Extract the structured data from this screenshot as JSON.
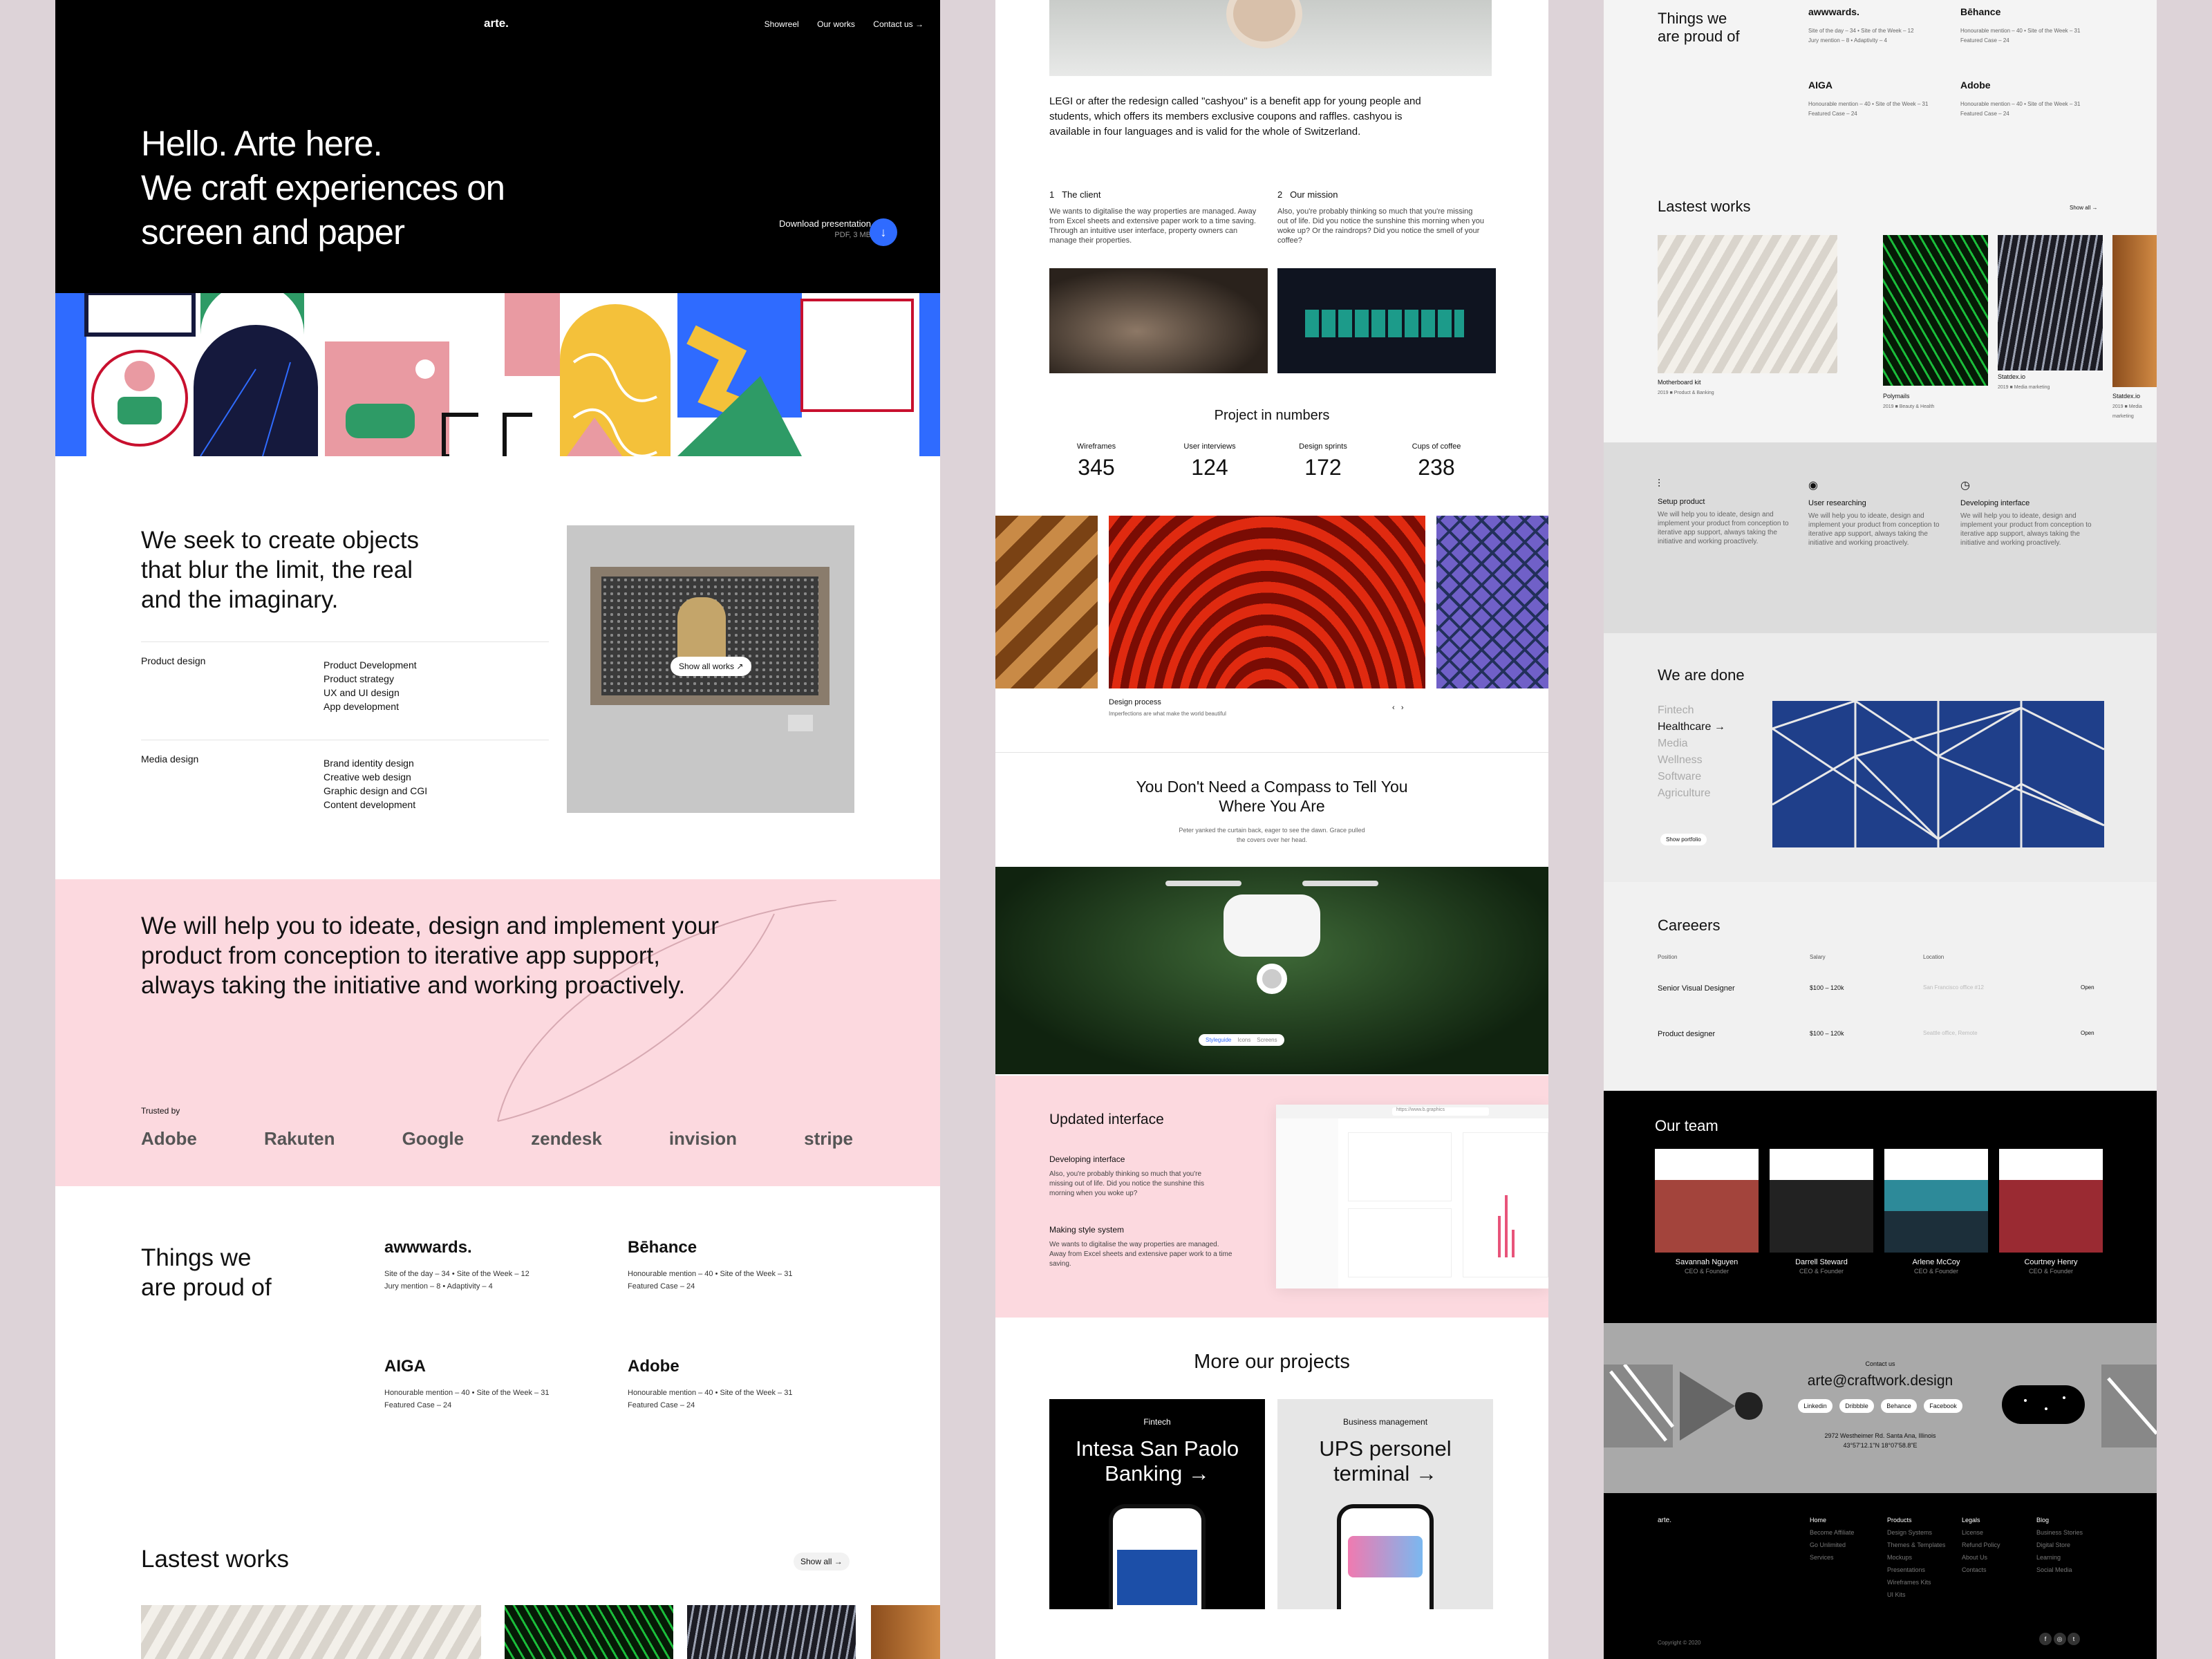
{
  "home": {
    "logo": "arte.",
    "nav": [
      "Showreel",
      "Our works",
      "Contact us →"
    ],
    "hero_title": "Hello. Arte here.\nWe craft experiences on\nscreen and paper",
    "download_label": "Download presentation",
    "download_meta": "PDF, 3 MB",
    "download_icon": "↓",
    "seek_text": "We seek to create objects\nthat blur the limit, the real\nand the imaginary.",
    "services": [
      {
        "heading": "Product design",
        "items": "Product Development\nProduct strategy\nUX and UI design\nApp development"
      },
      {
        "heading": "Media design",
        "items": "Brand identity design\nCreative web design\nGraphic design and CGI\nContent development"
      }
    ],
    "show_all_works": "Show all works ↗",
    "help_text": "We will help you to ideate, design and implement your product from conception to iterative app support, always taking the initiative and working proactively.",
    "trusted_by": "Trusted by",
    "client_logos": [
      "Adobe",
      "Rakuten",
      "Google",
      "zendesk",
      "invision",
      "stripe"
    ],
    "proud_title": "Things we\nare proud of",
    "awards": [
      {
        "name": "awwwards.",
        "text": "Site of the day – 34  •  Site of the Week – 12\nJury mention – 8  •  Adaptivity – 4"
      },
      {
        "name": "Bēhance",
        "text": "Honourable mention – 40  •  Site of the Week – 31\nFeatured Case – 24"
      },
      {
        "name": "AIGA",
        "text": "Honourable mention – 40  •  Site of the Week – 31\nFeatured Case – 24"
      },
      {
        "name": "Adobe",
        "text": "Honourable mention – 40  •  Site of the Week – 31\nFeatured Case – 24"
      }
    ],
    "latest_title": "Lastest works",
    "show_all": "Show all →"
  },
  "project": {
    "description": "LEGI or after the redesign called \"cashyou\" is a benefit app for young people and students, which offers its members exclusive coupons and raffles. cashyou is available in four languages and is valid for the whole of Switzerland.",
    "client": {
      "num": "1",
      "title": "The client",
      "text": "We wants to digitalise the way properties are managed. Away from Excel sheets and extensive paper work to a time saving. Through an intuitive user interface, property owners can manage their properties."
    },
    "mission": {
      "num": "2",
      "title": "Our mission",
      "text": "Also, you're probably thinking so much that you're missing out of life. Did you notice the sunshine this morning when you woke up? Or the raindrops? Did you notice the smell of your coffee?"
    },
    "numbers_title": "Project in numbers",
    "stats": [
      {
        "label": "Wireframes",
        "value": "345"
      },
      {
        "label": "User interviews",
        "value": "124"
      },
      {
        "label": "Design sprints",
        "value": "172"
      },
      {
        "label": "Cups of coffee",
        "value": "238"
      }
    ],
    "process_title": "Design process",
    "process_sub": "Imperfections are what make the world beautiful",
    "compass_title": "You Don't Need a Compass to Tell You\nWhere You Are",
    "compass_sub": "Peter yanked the curtain back, eager to see the dawn. Grace pulled\nthe covers over her head.",
    "drone_tabs": [
      "Styleguide",
      "Icons",
      "Screens"
    ],
    "updated_title": "Updated interface",
    "dev_title": "Developing interface",
    "dev_text": "Also, you're probably thinking so much that you're missing out of life. Did you notice the sunshine this morning when you woke up?",
    "style_title": "Making style system",
    "style_text": "We wants to digitalise the way properties are managed. Away from Excel sheets and extensive paper work to a time saving.",
    "browser_url": "https://www.b.graphics",
    "more_title": "More our projects",
    "cards": [
      {
        "category": "Fintech",
        "title": "Intesa San Paolo\nBanking →"
      },
      {
        "category": "Business management",
        "title": "UPS personel\nterminal →"
      }
    ]
  },
  "overview": {
    "proud_title": "Things we\nare proud of",
    "latest_title": "Lastest works",
    "show_all": "Show all →",
    "works": [
      {
        "name": "Motherboard kit",
        "meta": "2019 ■ Product & Banking"
      },
      {
        "name": "Polymails",
        "meta": "2019 ■ Beauty & Health"
      },
      {
        "name": "Statdex.io",
        "meta": "2019 ■ Media marketing"
      },
      {
        "name": "Statdex.io",
        "meta": "2019 ■ Media marketing"
      }
    ],
    "features": [
      {
        "title": "Setup product",
        "text": "We will help you to ideate, design and implement your product from conception to iterative app support, always taking the initiative and working proactively."
      },
      {
        "title": "User researching",
        "text": "We will help you to ideate, design and implement your product from conception to iterative app support, always taking the initiative and working proactively."
      },
      {
        "title": "Developing interface",
        "text": "We will help you to ideate, design and implement your product from conception to iterative app support, always taking the initiative and working proactively."
      }
    ],
    "done_title": "We are done",
    "industries": [
      "Fintech",
      "Healthcare →",
      "Media",
      "Wellness",
      "Software",
      "Agriculture"
    ],
    "show_portfolio": "Show portfolio",
    "careers_title": "Careeers",
    "career_headers": [
      "Position",
      "Salary",
      "Location"
    ],
    "careers": [
      {
        "position": "Senior Visual Designer",
        "salary": "$100 – 120k",
        "location": "San Francisco office #12",
        "action": "Open"
      },
      {
        "position": "Product designer",
        "salary": "$100 – 120k",
        "location": "Seattle office, Remote",
        "action": "Open"
      }
    ],
    "team_title": "Our team",
    "team": [
      {
        "name": "Savannah Nguyen",
        "role": "CEO & Founder"
      },
      {
        "name": "Darrell Steward",
        "role": "CEO & Founder"
      },
      {
        "name": "Arlene McCoy",
        "role": "CEO & Founder"
      },
      {
        "name": "Courtney Henry",
        "role": "CEO & Founder"
      }
    ],
    "contact_label": "Contact us",
    "email": "arte@craftwork.design",
    "socials": [
      "Linkedin",
      "Dribbble",
      "Behance",
      "Facebook"
    ],
    "address": "2972 Westheimer Rd. Santa Ana, Illinois\n43°57'12.1\"N 18°07'58.8\"E",
    "footer_logo": "arte.",
    "footer_cols": [
      {
        "title": "Home",
        "links": "Become Affiliate\nGo Unlimited\nServices"
      },
      {
        "title": "Products",
        "links": "Design Systems\nThemes & Templates\nMockups\nPresentations\nWireframes Kits\nUI Kits"
      },
      {
        "title": "Legals",
        "links": "License\nRefund Policy\nAbout Us\nContacts"
      },
      {
        "title": "Blog",
        "links": "Business Stories\nDigital Store\nLearning\nSocial Media"
      }
    ],
    "copyright": "Copyright © 2020"
  },
  "colors": {
    "accent_blue": "#2f6bff",
    "pink": "#fcd9df",
    "green": "#2e9b66",
    "yellow": "#f4c13a",
    "navy": "#15193d",
    "red": "#c8102e"
  }
}
